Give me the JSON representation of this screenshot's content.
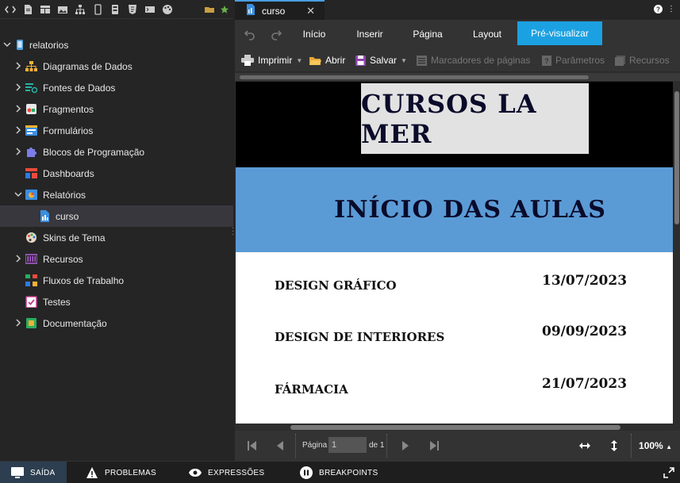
{
  "editor": {
    "tab": {
      "label": "curso",
      "close": "✕"
    },
    "window_icons": {
      "help": "?",
      "menu": "⋮"
    }
  },
  "explorer": {
    "root": {
      "label": "relatorios"
    },
    "items": [
      {
        "label": "Diagramas de Dados",
        "icon": "data-diagram-icon"
      },
      {
        "label": "Fontes de Dados",
        "icon": "data-source-icon"
      },
      {
        "label": "Fragmentos",
        "icon": "fragment-icon"
      },
      {
        "label": "Formulários",
        "icon": "form-icon"
      },
      {
        "label": "Blocos de Programação",
        "icon": "puzzle-icon"
      },
      {
        "label": "Dashboards",
        "icon": "dashboard-icon"
      },
      {
        "label": "Relatórios",
        "icon": "report-icon"
      },
      {
        "label": "curso",
        "icon": "report-file-icon"
      },
      {
        "label": "Skins de Tema",
        "icon": "palette-icon"
      },
      {
        "label": "Recursos",
        "icon": "resources-icon"
      },
      {
        "label": "Fluxos de Trabalho",
        "icon": "workflow-icon"
      },
      {
        "label": "Testes",
        "icon": "test-icon"
      },
      {
        "label": "Documentação",
        "icon": "documentation-icon"
      }
    ]
  },
  "ribbon": {
    "tabs": [
      "Início",
      "Inserir",
      "Página",
      "Layout",
      "Pré-visualizar"
    ],
    "active_tab": "Pré-visualizar",
    "toolbar": {
      "print": "Imprimir",
      "open": "Abrir",
      "save": "Salvar",
      "bookmarks": "Marcadores de páginas",
      "parameters": "Parâmetros",
      "resources": "Recursos"
    }
  },
  "report": {
    "title": "CURSOS LA MER",
    "subtitle": "INÍCIO DAS AULAS",
    "rows": [
      {
        "course": "DESIGN GRÁFICO",
        "date": "13/07/2023"
      },
      {
        "course": "DESIGN DE INTERIORES",
        "date": "09/09/2023"
      },
      {
        "course": "FÁRMACIA",
        "date": "21/07/2023"
      }
    ]
  },
  "pager": {
    "page_label": "Página",
    "page_value": "1",
    "of_label": "de 1",
    "zoom": "100%"
  },
  "statusbar": {
    "output": "SAÍDA",
    "problems": "PROBLEMAS",
    "expressions": "EXPRESSÕES",
    "breakpoints": "BREAKPOINTS"
  },
  "colors": {
    "accent": "#1ba1e2",
    "report_blue_band": "#5b9bd5"
  }
}
